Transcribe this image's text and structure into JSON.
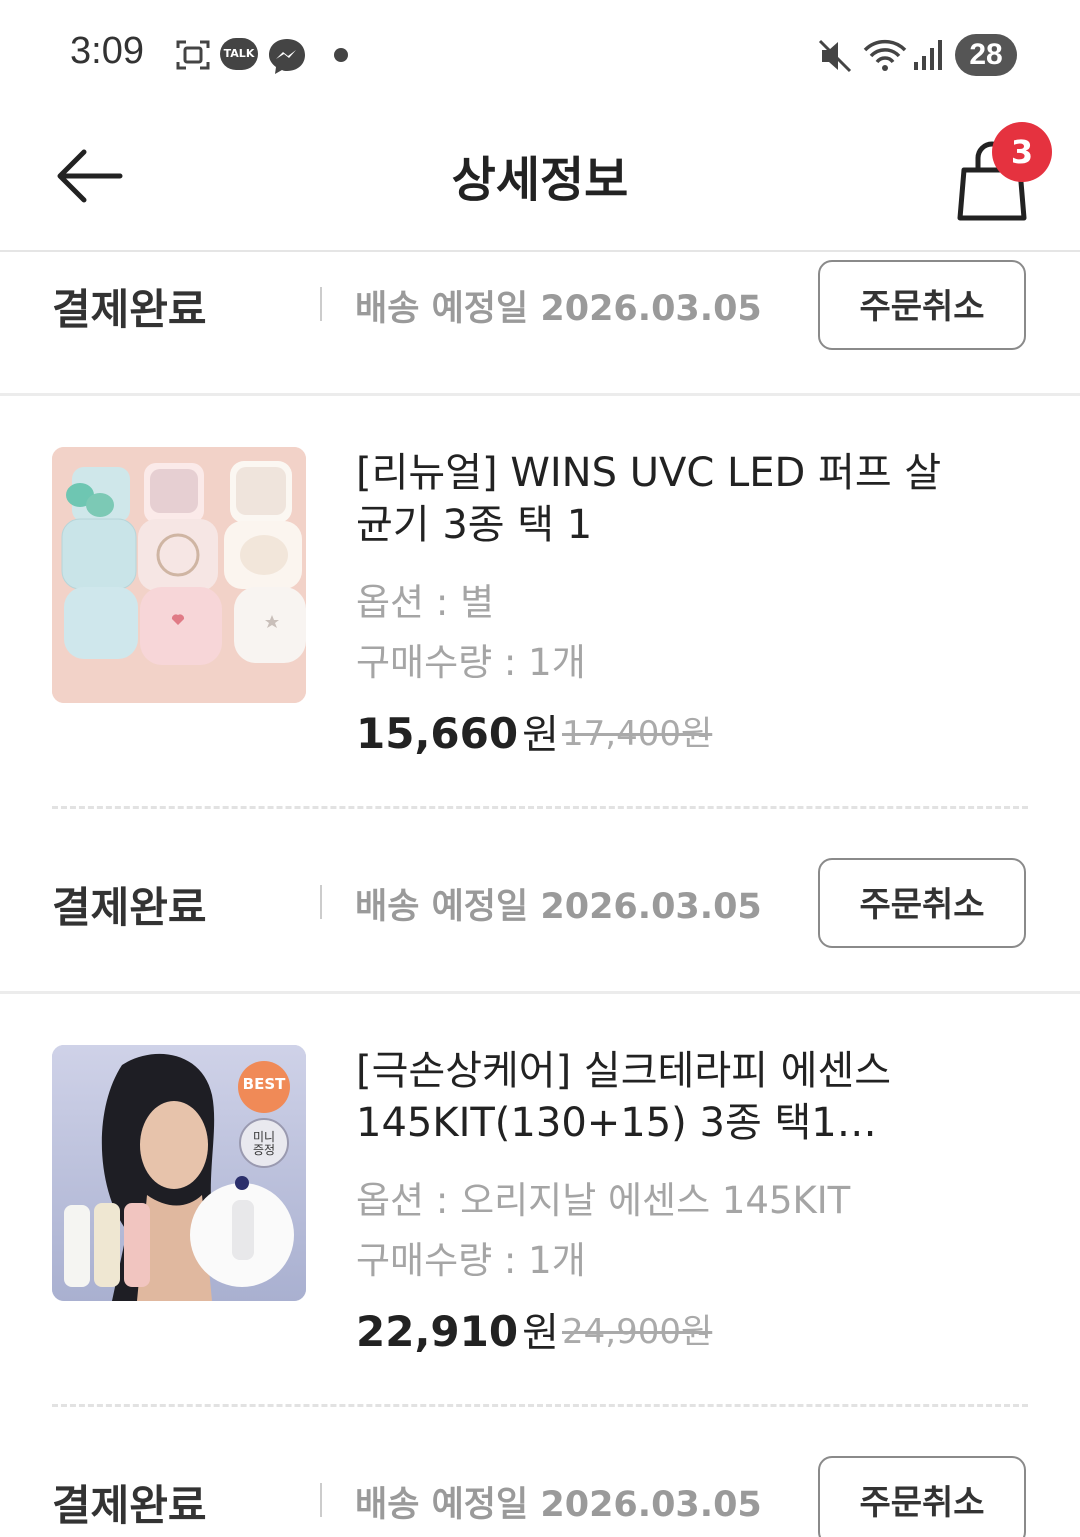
{
  "status_bar": {
    "time": "3:09",
    "talk_label": "TALK",
    "battery": "28",
    "icons": [
      "screenshot-icon",
      "kakaotalk-icon",
      "messenger-icon",
      "mute-icon",
      "wifi-icon",
      "signal-icon"
    ]
  },
  "header": {
    "title": "상세정보",
    "cart_count": "3",
    "back_icon": "arrow-left-icon",
    "cart_icon": "shopping-bag-icon"
  },
  "orders": [
    {
      "status": "결제완료",
      "delivery": "배송 예정일 2026.03.05",
      "cancel_label": "주문취소"
    },
    {
      "status": "결제완료",
      "delivery": "배송 예정일 2026.03.05",
      "cancel_label": "주문취소"
    },
    {
      "status": "결제완료",
      "delivery": "배송 예정일 2026.03.05",
      "cancel_label": "주문취소"
    }
  ],
  "products": [
    {
      "name": "[리뉴얼] WINS UVC LED 퍼프 살균기 3종 택 1",
      "option": "옵션 : 별",
      "quantity": "구매수량 : 1개",
      "price": "15,660",
      "currency": "원",
      "original_price": "17,400원"
    },
    {
      "name": "[극손상케어] 실크테라피 에센스 145KIT(130+15) 3종 택1…",
      "option": "옵션 : 오리지날 에센스 145KIT",
      "quantity": "구매수량 : 1개",
      "price": "22,910",
      "currency": "원",
      "original_price": "24,900원",
      "thumb_badges": {
        "best": "BEST",
        "gift": "미니 증정"
      }
    }
  ]
}
